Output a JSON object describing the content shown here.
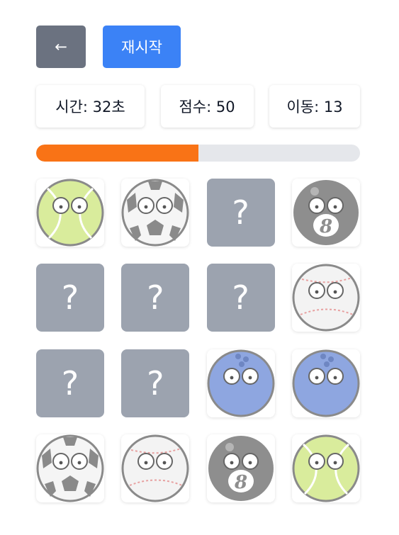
{
  "toolbar": {
    "back_icon": "arrow-left-icon",
    "back_glyph": "←",
    "restart_label": "재시작"
  },
  "stats": {
    "time_label": "시간: 32초",
    "score_label": "점수: 50",
    "moves_label": "이동: 13"
  },
  "progress": {
    "value": 0.5,
    "color": "#f97316",
    "track_color": "#e5e7eb"
  },
  "board": {
    "columns": 4,
    "hidden_glyph": "?",
    "cards": [
      {
        "state": "revealed",
        "ball": "tennis"
      },
      {
        "state": "revealed",
        "ball": "soccer"
      },
      {
        "state": "hidden",
        "ball": null
      },
      {
        "state": "revealed",
        "ball": "billiard-8"
      },
      {
        "state": "hidden",
        "ball": null
      },
      {
        "state": "hidden",
        "ball": null
      },
      {
        "state": "hidden",
        "ball": null
      },
      {
        "state": "revealed",
        "ball": "baseball"
      },
      {
        "state": "hidden",
        "ball": null
      },
      {
        "state": "hidden",
        "ball": null
      },
      {
        "state": "revealed",
        "ball": "bowling"
      },
      {
        "state": "revealed",
        "ball": "bowling"
      },
      {
        "state": "revealed",
        "ball": "soccer"
      },
      {
        "state": "revealed",
        "ball": "baseball"
      },
      {
        "state": "revealed",
        "ball": "billiard-8"
      },
      {
        "state": "revealed",
        "ball": "tennis"
      }
    ]
  },
  "colors": {
    "back_button": "#6b7280",
    "restart_button": "#3b82f6",
    "hidden_card": "#9ca3af"
  }
}
